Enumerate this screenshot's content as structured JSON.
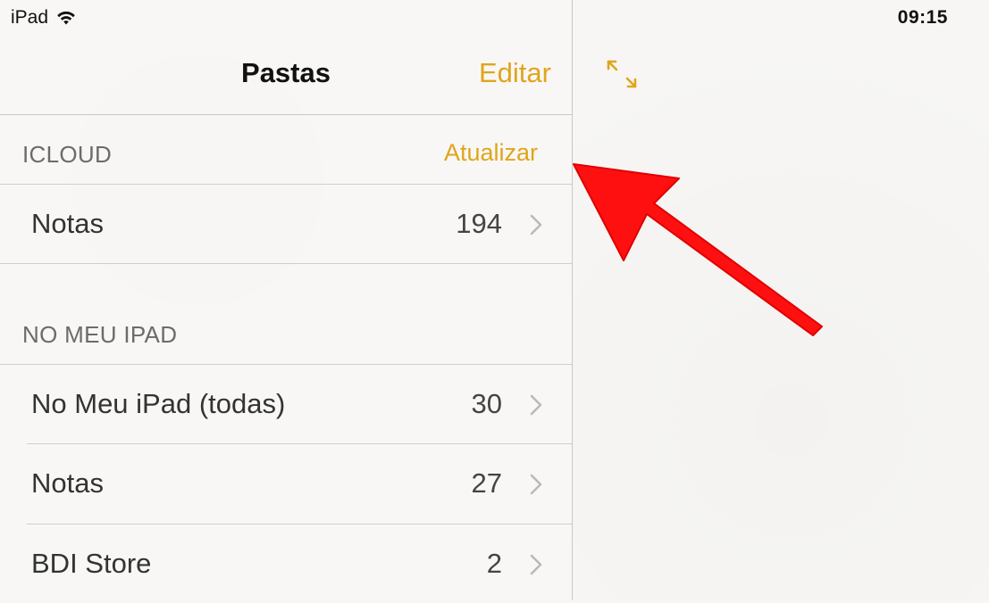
{
  "status_bar": {
    "device": "iPad",
    "wifi_icon": "wifi-icon",
    "time": "09:15"
  },
  "nav": {
    "title": "Pastas",
    "edit_label": "Editar"
  },
  "sections": [
    {
      "header": "ICLOUD",
      "action": "Atualizar",
      "rows": [
        {
          "label": "Notas",
          "count": "194"
        }
      ]
    },
    {
      "header": "NO MEU IPAD",
      "rows": [
        {
          "label": "No Meu iPad (todas)",
          "count": "30"
        },
        {
          "label": "Notas",
          "count": "27"
        },
        {
          "label": "BDI Store",
          "count": "2"
        }
      ]
    }
  ],
  "icons": {
    "expand": "expand-arrows-icon",
    "chevron": "chevron-right-icon",
    "annotation": "red-arrow-annotation"
  },
  "colors": {
    "accent": "#e0a51c",
    "annotation": "#ff1010",
    "separator": "#c9c8c6",
    "section_header": "#6b6b6b"
  }
}
